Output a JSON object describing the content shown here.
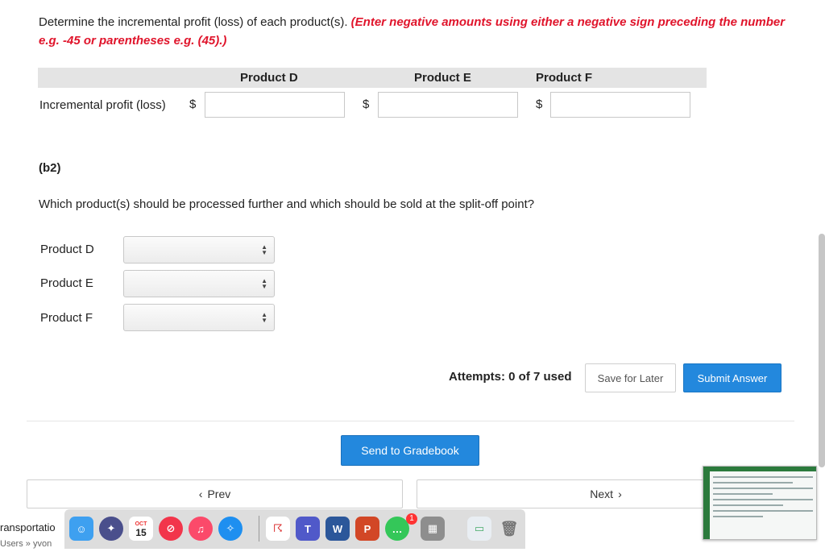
{
  "instructions": {
    "plain": "Determine the incremental profit (loss) of each product(s).",
    "highlight": "(Enter negative amounts using either a negative sign preceding the number e.g. -45 or parentheses e.g. (45).)"
  },
  "table": {
    "columns": [
      "Product D",
      "Product E",
      "Product F"
    ],
    "row_label": "Incremental profit (loss)",
    "currency": "$",
    "values": [
      "",
      "",
      ""
    ]
  },
  "part": {
    "label": "(b2)",
    "question": "Which product(s) should be processed further and which should be sold at the split-off point?",
    "rows": [
      {
        "label": "Product D",
        "selected": ""
      },
      {
        "label": "Product E",
        "selected": ""
      },
      {
        "label": "Product F",
        "selected": ""
      }
    ]
  },
  "footer": {
    "attempts": "Attempts: 0 of 7 used",
    "save_later": "Save for Later",
    "submit": "Submit Answer",
    "gradebook": "Send to Gradebook",
    "prev": "Prev",
    "next": "Next"
  },
  "finder": {
    "title": "ransportatio",
    "path": "Users » yvon"
  },
  "dock": {
    "calendar_month": "OCT",
    "calendar_day": "15",
    "teams_letter": "T",
    "word_letter": "W",
    "ppt_letter": "P",
    "badge": "1",
    "icons": [
      "finder-icon",
      "launchpad-icon",
      "calendar-icon",
      "news-icon",
      "music-icon",
      "safari-icon",
      "acrobat-icon",
      "teams-icon",
      "word-icon",
      "powerpoint-icon",
      "messages-icon",
      "calculator-icon",
      "preview-icon",
      "trash-icon"
    ],
    "colors": {
      "finder": "#3ea0f0",
      "launchpad": "#4a4f8c",
      "news": "#f2354b",
      "music": "#fb4a6a",
      "safari": "#1e8ff0",
      "acrobat": "#d71b1b",
      "teams": "#5059c9",
      "word": "#2b579a",
      "powerpoint": "#d24726",
      "messages": "#34c759",
      "calculator": "#8e8e8e"
    }
  },
  "colors": {
    "accent": "#2388dd",
    "instruction_red": "#e0142b",
    "header_bar": "#e4e4e4"
  }
}
